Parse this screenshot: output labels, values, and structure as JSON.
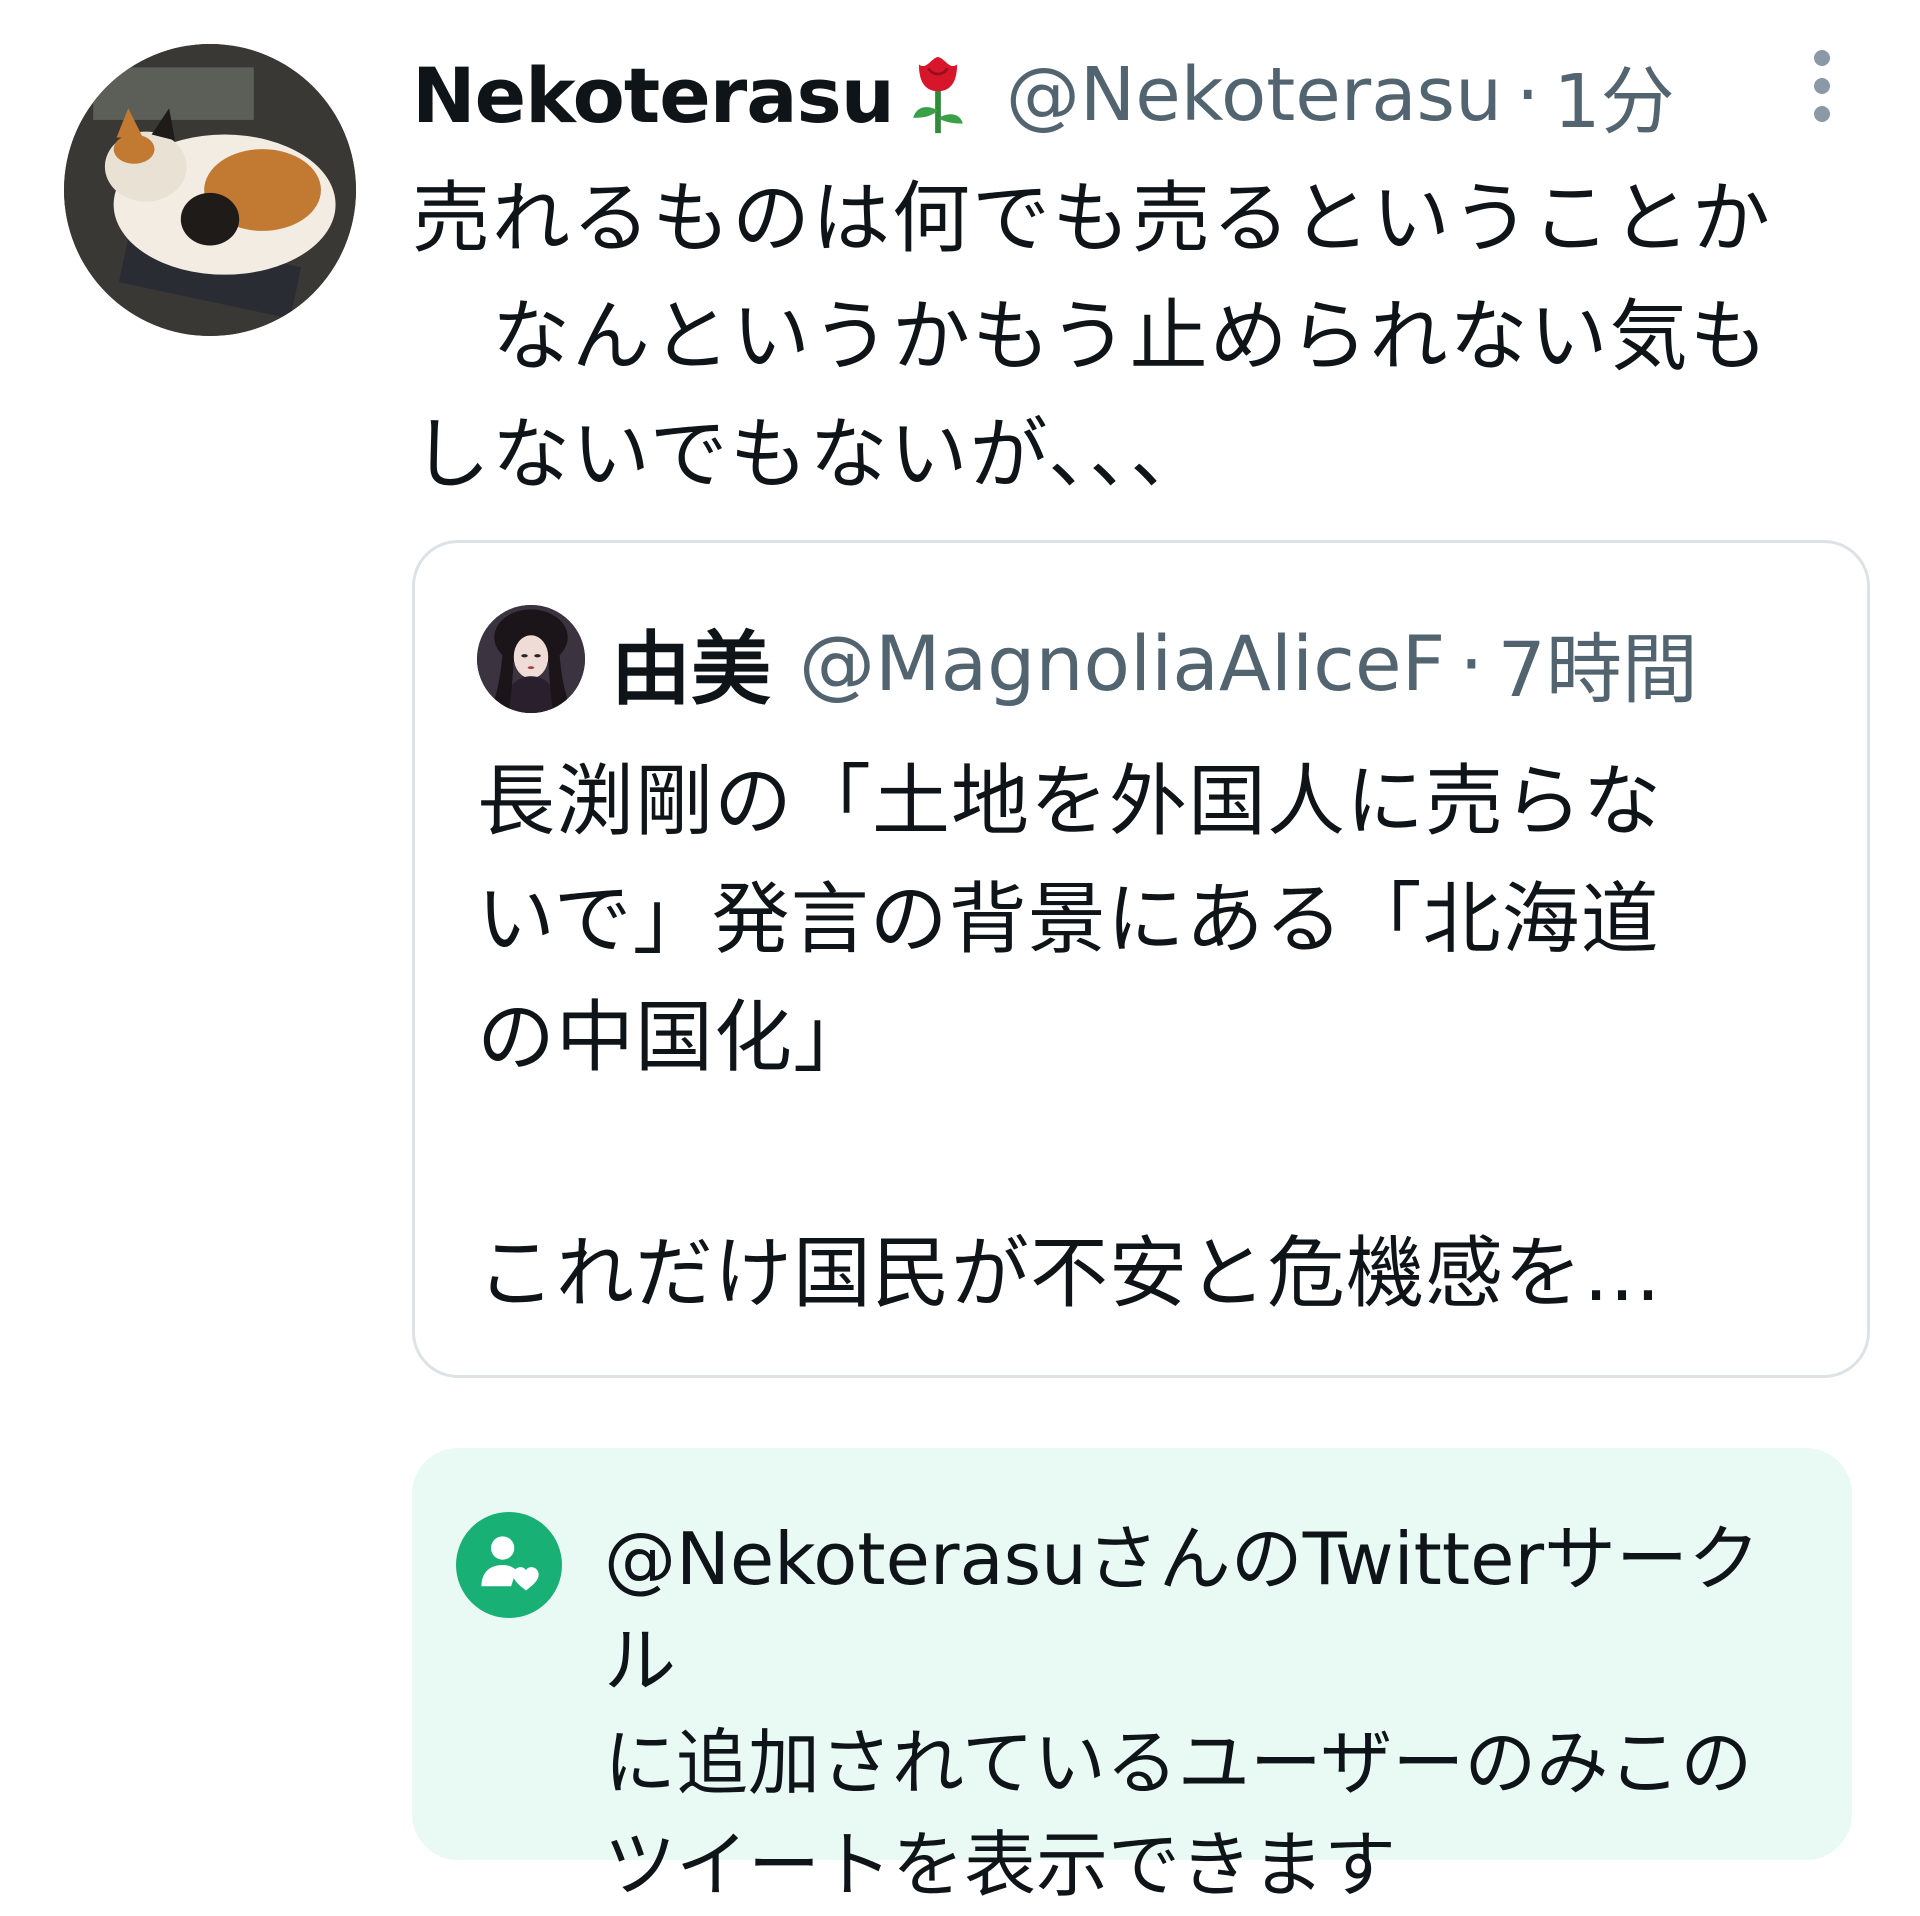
{
  "tweet": {
    "author": {
      "display_name": "Nekoterasu",
      "name_emoji": "rose-emoji",
      "handle": "@Nekoterasu",
      "avatar": "calico-cat-avatar"
    },
    "separator": "·",
    "time": "1分",
    "more_icon": "more-vertical-icon",
    "text": "売れるものは何でも売るということか\n　なんというかもう止められない気も\nしないでもないが、、、"
  },
  "quote": {
    "author": {
      "display_name": "由美",
      "handle": "@MagnoliaAliceF",
      "avatar": "woman-portrait-avatar"
    },
    "separator": "·",
    "time": "7時間",
    "text": "長渕剛の「土地を外国人に売らな\nいで」発言の背景にある「北海道\nの中国化」\n\nこれだけ国民が不安と危機感を…"
  },
  "circle_notice": {
    "icon": "twitter-circle-icon",
    "text": "@NekoterasuさんのTwitterサークル\nに追加されているユーザーのみこの\nツイートを表示できます",
    "accent_color": "#19b076",
    "background_color": "#e9faf5"
  },
  "colors": {
    "primary_text": "#0f1419",
    "secondary_text": "#536471",
    "border": "#dde2e6"
  }
}
